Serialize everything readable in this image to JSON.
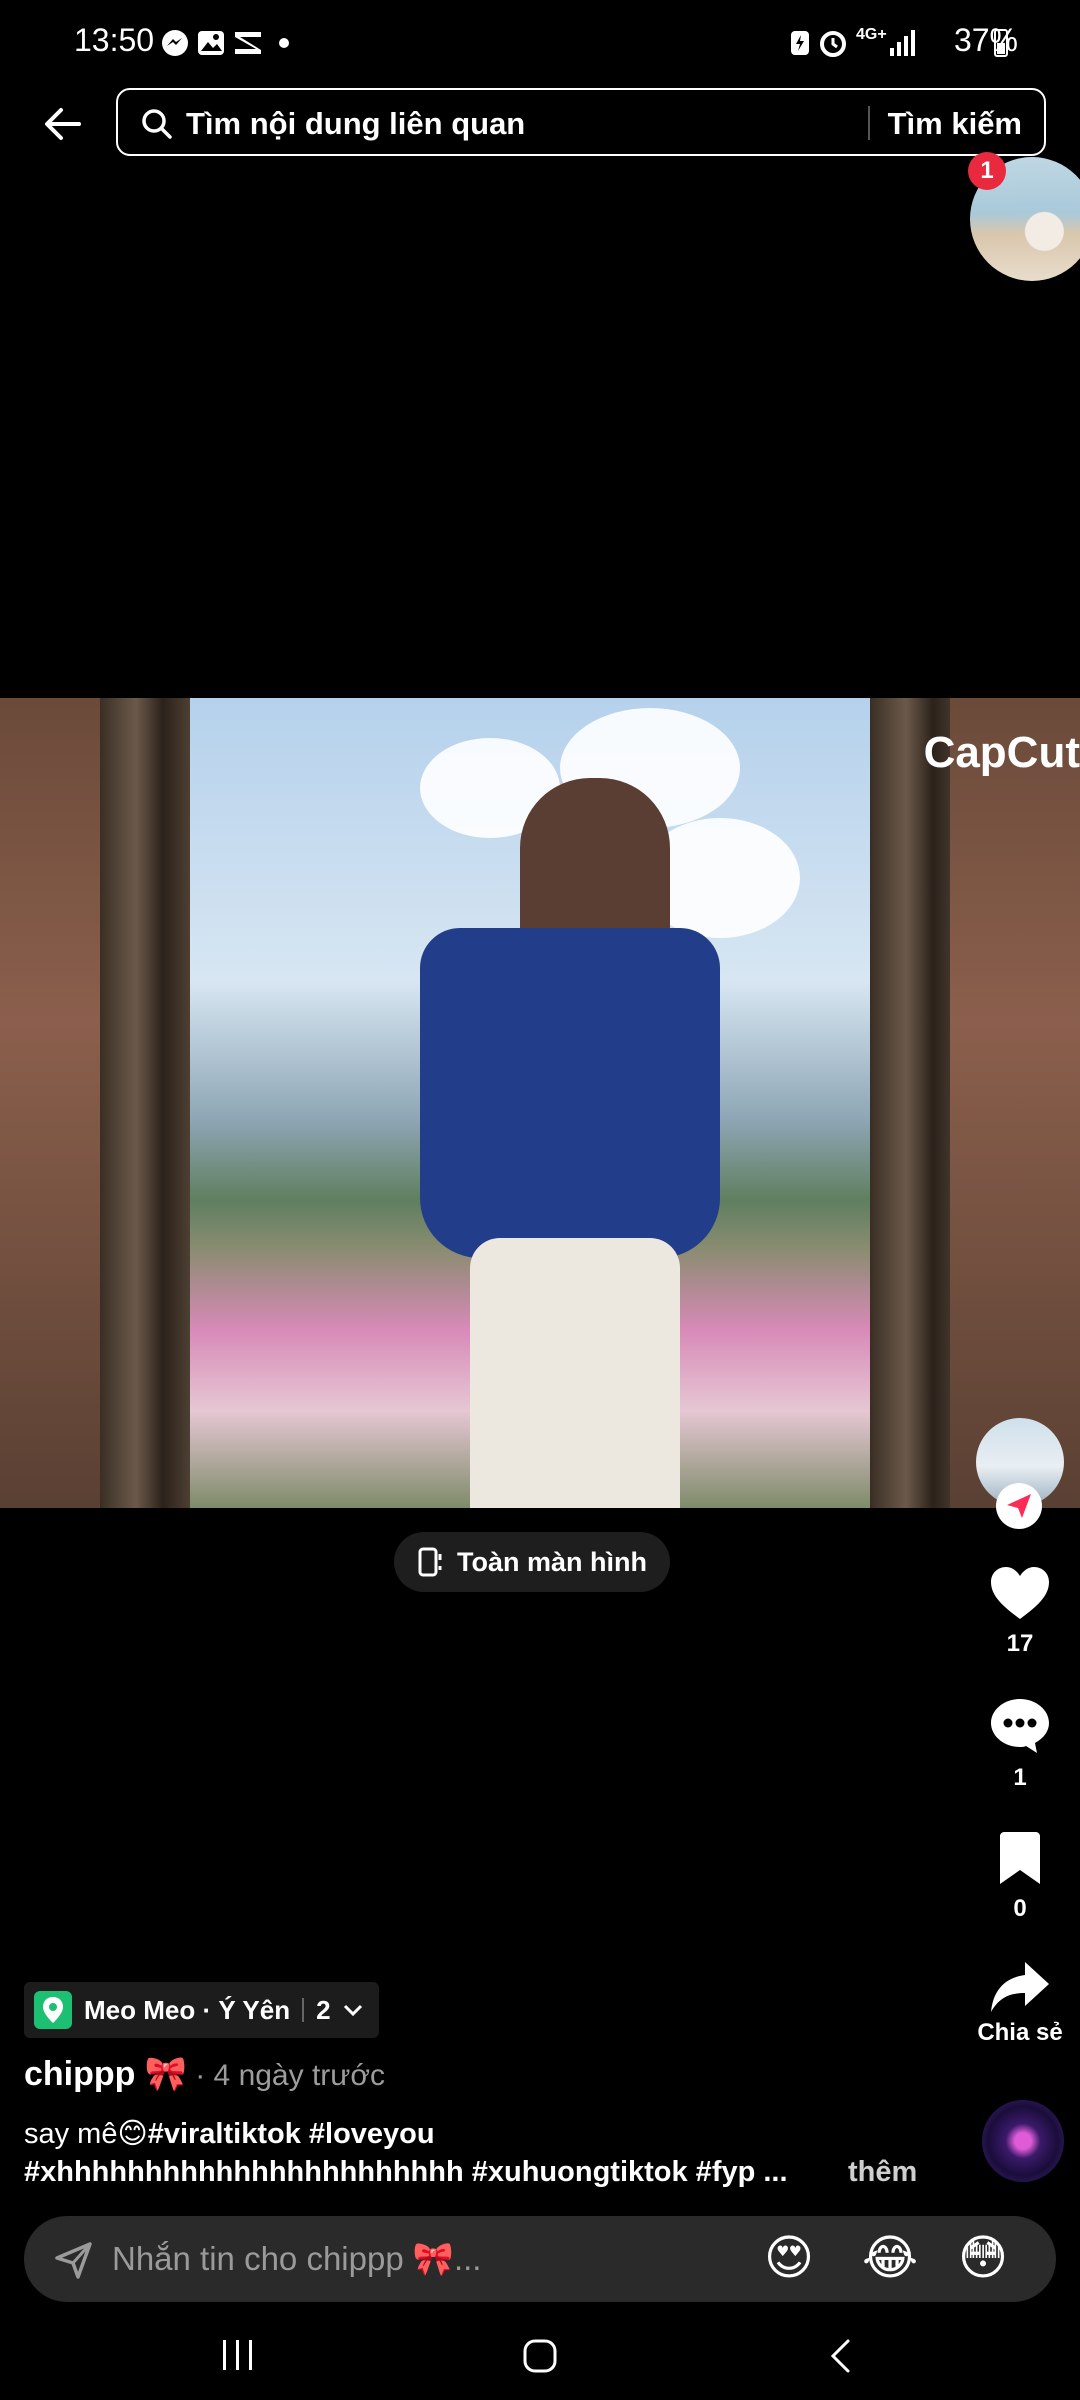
{
  "status": {
    "time": "13:50",
    "battery": "37%",
    "network": "4G+"
  },
  "search": {
    "placeholder": "Tìm nội dung liên quan",
    "button": "Tìm kiếm"
  },
  "profile": {
    "notification_count": "1"
  },
  "video": {
    "watermark": "CapCut",
    "fullscreen_label": "Toàn màn hình"
  },
  "actions": {
    "likes": "17",
    "comments": "1",
    "saves": "0",
    "share_label": "Chia sẻ"
  },
  "post": {
    "location_name": "Meo Meo · Ý Yên",
    "location_count": "2",
    "username": "chippp 🎀",
    "time": "· 4 ngày trước",
    "caption_line1_text": "say mê😊",
    "caption_line1_tags": "#viraltiktok #loveyou",
    "caption_line2": "#xhhhhhhhhhhhhhhhhhhhhhhh #xuhuongtiktok #fyp ...",
    "more": "thêm"
  },
  "message": {
    "placeholder": "Nhắn tin cho chippp 🎀...",
    "emojis": [
      "😍",
      "😂",
      "😳"
    ]
  },
  "colors": {
    "background": "#000000",
    "badge_red": "#e8293e",
    "location_green": "#1dbf73",
    "follow_red": "#fe2c55"
  }
}
